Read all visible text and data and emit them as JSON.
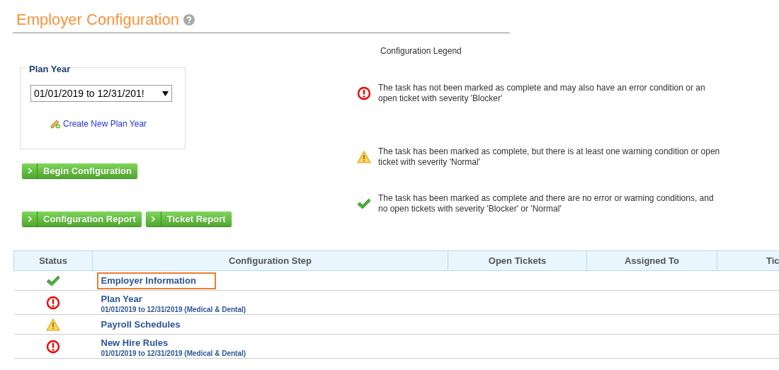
{
  "page": {
    "title": "Employer Configuration"
  },
  "plan_year": {
    "legend": "Plan Year",
    "value": "01/01/2019 to 12/31/201!",
    "create_link": "Create New Plan Year"
  },
  "begin_button": {
    "label": "Begin Configuration"
  },
  "report_buttons": [
    {
      "label": "Configuration Report"
    },
    {
      "label": "Ticket Report"
    }
  ],
  "legend": {
    "title": "Configuration Legend",
    "items": [
      {
        "kind": "error",
        "text": "The task has not been marked as complete and may also have an error condition or an open ticket with severity 'Blocker'"
      },
      {
        "kind": "warning",
        "text": "The task has been marked as complete, but there is at least one warning condition or open ticket with severity 'Normal'"
      },
      {
        "kind": "complete",
        "text": "The task has been marked as complete and there are no error or warning conditions, and no open tickets with severity 'Blocker' or 'Normal'"
      }
    ]
  },
  "table": {
    "columns": [
      "Status",
      "Configuration Step",
      "Open Tickets",
      "Assigned To",
      "Tic"
    ],
    "rows": [
      {
        "kind": "complete",
        "step": "Employer Information",
        "selected": true
      },
      {
        "kind": "error",
        "step": "Plan Year",
        "detail": "01/01/2019 to 12/31/2019 (Medical & Dental)",
        "selected": false
      },
      {
        "kind": "warning",
        "step": "Payroll Schedules",
        "selected": false
      },
      {
        "kind": "error",
        "step": "New Hire Rules",
        "detail": "01/01/2019 to 12/31/2019 (Medical & Dental)",
        "selected": false
      }
    ]
  }
}
